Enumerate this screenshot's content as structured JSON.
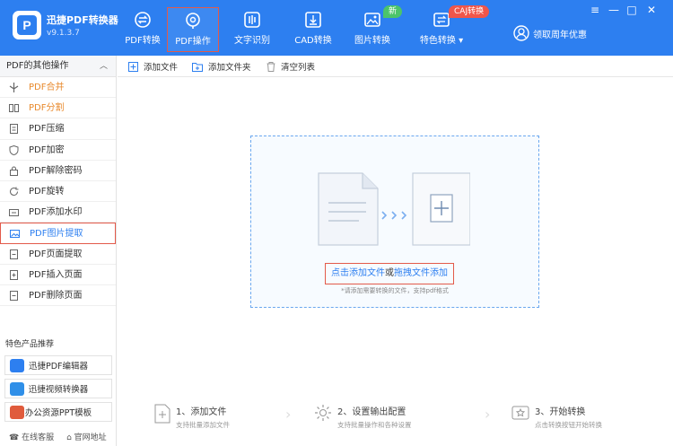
{
  "app": {
    "name": "迅捷PDF转换器",
    "version": "v9.1.3.7",
    "logo_letter": "P"
  },
  "nav": [
    {
      "label": "PDF转换"
    },
    {
      "label": "PDF操作"
    },
    {
      "label": "文字识别"
    },
    {
      "label": "CAD转换"
    },
    {
      "label": "图片转换",
      "badge": "新"
    },
    {
      "label": "特色转换 ▾",
      "badge": "CAJ转换"
    }
  ],
  "promo_label": "领取周年优惠",
  "window_controls": {
    "menu": "≡",
    "minimize": "—",
    "maximize": "□",
    "close": "✕"
  },
  "sidebar": {
    "header": "PDF的其他操作",
    "items": [
      {
        "label": "PDF合并"
      },
      {
        "label": "PDF分割"
      },
      {
        "label": "PDF压缩"
      },
      {
        "label": "PDF加密"
      },
      {
        "label": "PDF解除密码"
      },
      {
        "label": "PDF旋转"
      },
      {
        "label": "PDF添加水印"
      },
      {
        "label": "PDF图片提取"
      },
      {
        "label": "PDF页面提取"
      },
      {
        "label": "PDF插入页面"
      },
      {
        "label": "PDF删除页面"
      }
    ],
    "recommend_title": "特色产品推荐",
    "recommend": [
      {
        "label": "迅捷PDF编辑器"
      },
      {
        "label": "迅捷视频转换器"
      },
      {
        "label": "办公资源PPT模板"
      }
    ],
    "footer": {
      "service": "在线客服",
      "website": "官网地址"
    }
  },
  "toolbar": {
    "add_file": "添加文件",
    "add_folder": "添加文件夹",
    "clear_list": "清空列表"
  },
  "dropzone": {
    "click_add": "点击添加文件",
    "or": "或",
    "drag_add": "拖拽文件添加",
    "hint": "*请添加需要转换的文件，支持pdf格式"
  },
  "steps": [
    {
      "title": "1、添加文件",
      "desc": "支持批量添加文件"
    },
    {
      "title": "2、设置输出配置",
      "desc": "支持批量操作和各种设置"
    },
    {
      "title": "3、开始转换",
      "desc": "点击转换按钮开始转换"
    }
  ],
  "colors": {
    "header_bg": "#2d7ff0",
    "accent_orange": "#e8892c",
    "highlight_red": "#e35a4a",
    "link_blue": "#2d7ff0"
  }
}
